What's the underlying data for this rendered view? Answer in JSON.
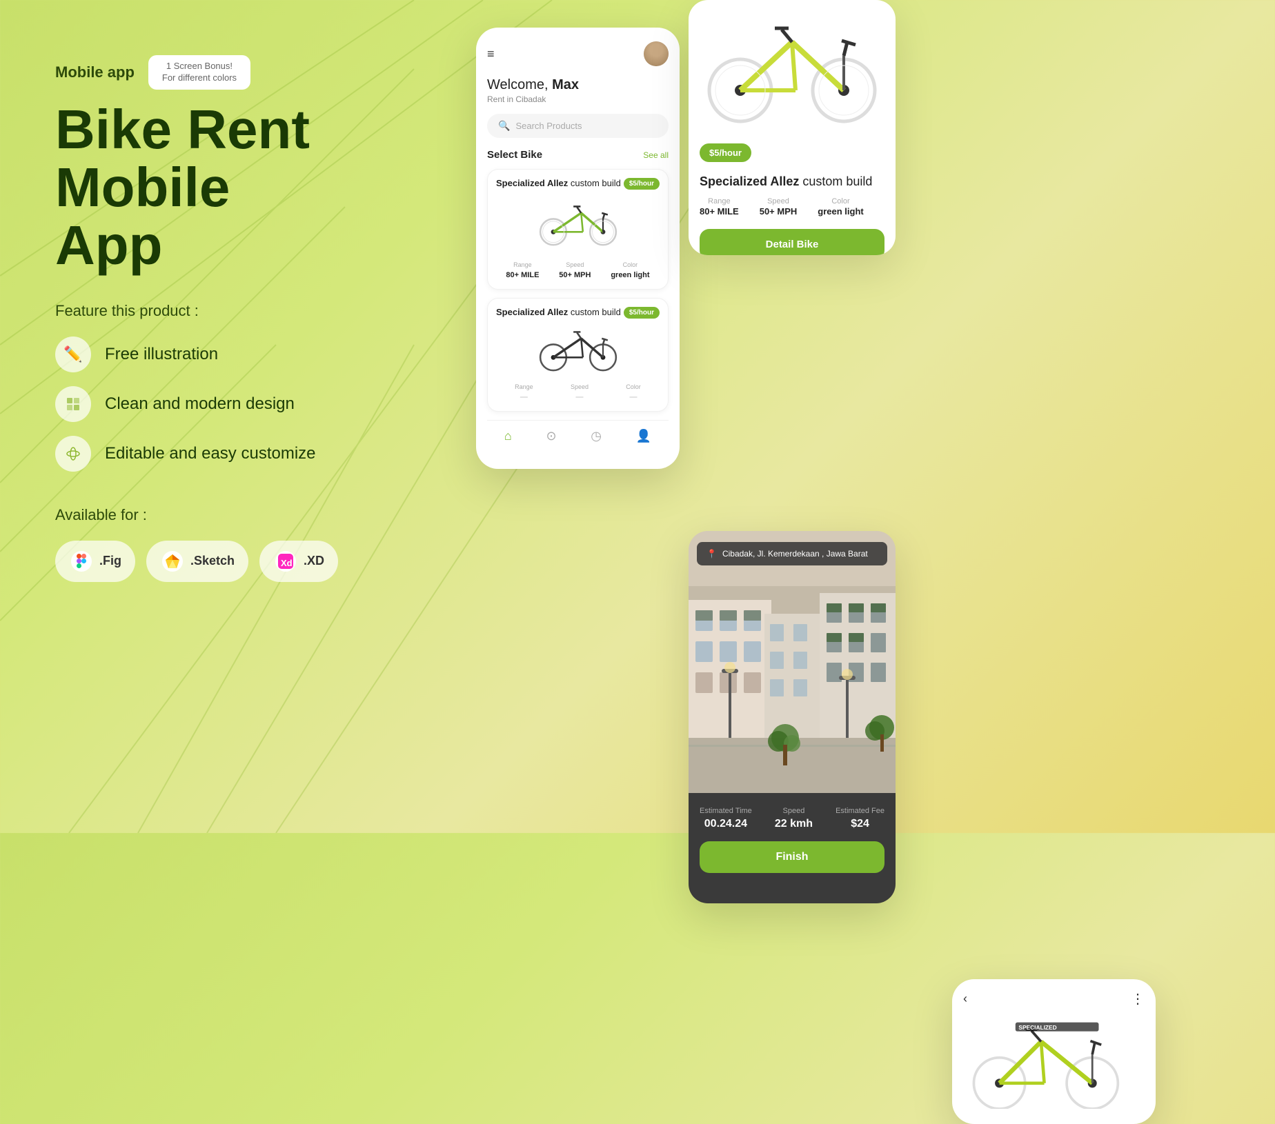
{
  "background": {
    "gradient_start": "#c8e06a",
    "gradient_end": "#e8d870"
  },
  "left": {
    "mobile_label": "Mobile app",
    "bonus_badge": "1 Screen Bonus!",
    "bonus_sub": "For different colors",
    "main_title_line1": "Bike Rent Mobile",
    "main_title_line2": "App",
    "feature_label": "Feature this product :",
    "features": [
      {
        "icon": "✏️",
        "text": "Free illustration"
      },
      {
        "icon": "🎨",
        "text": "Clean and modern design"
      },
      {
        "icon": "🌿",
        "text": "Editable and easy customize"
      }
    ],
    "available_label": "Available for :",
    "tools": [
      {
        "name": ".Fig",
        "color": "#F24E1E"
      },
      {
        "name": ".Sketch",
        "color": "#F7B500"
      },
      {
        "name": ".XD",
        "color": "#FF26BE"
      }
    ]
  },
  "phone_main": {
    "welcome": "Welcome,",
    "user": "Max",
    "location": "Rent in Cibadak",
    "search_placeholder": "Search Products",
    "section_title": "Select Bike",
    "see_all": "See all",
    "bikes": [
      {
        "name_bold": "Specialized Allez",
        "name_rest": " custom build",
        "price": "$5/hour",
        "range": "80+ MILE",
        "speed": "50+ MPH",
        "color": "green light",
        "color_accent": "#7cb82f"
      },
      {
        "name_bold": "Specialized Allez",
        "name_rest": " custom build",
        "price": "$5/hour",
        "range": "",
        "speed": "",
        "color": "",
        "color_accent": "#333"
      }
    ],
    "nav_items": [
      "home",
      "location",
      "clock",
      "user"
    ]
  },
  "phone_detail": {
    "price": "$5/hour",
    "title_bold": "Specialized Allez",
    "title_rest": " custom build",
    "specs": [
      {
        "label": "Range",
        "value": "80+ MILE"
      },
      {
        "label": "Speed",
        "value": "50+ MPH"
      },
      {
        "label": "Color",
        "value": "green light"
      }
    ],
    "button": "Detail Bike"
  },
  "phone_bottom": {
    "back_icon": "‹",
    "dots_icon": "⋮"
  },
  "phone_map": {
    "location_text": "Cibadak, Jl. Kemerdekaan , Jawa Barat",
    "stats": [
      {
        "label": "Estimated Time",
        "value": "00.24.24"
      },
      {
        "label": "Speed",
        "value": "22 kmh"
      },
      {
        "label": "Estimated Fee",
        "value": "$24"
      }
    ],
    "finish_button": "Finish"
  }
}
